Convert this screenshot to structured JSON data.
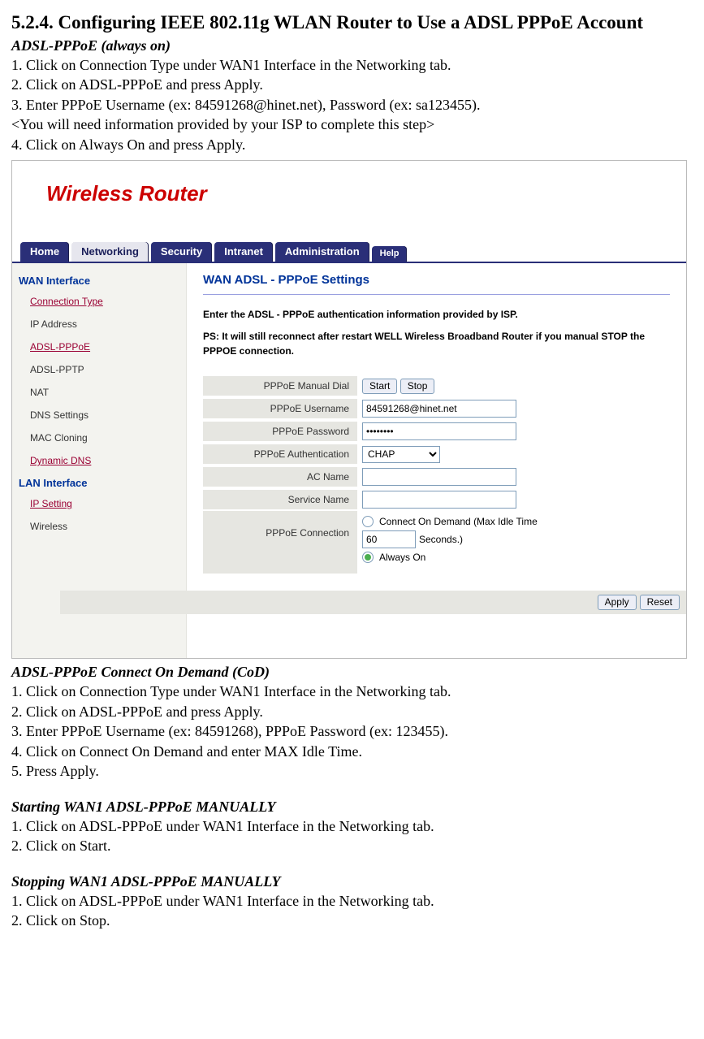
{
  "doc": {
    "heading": "5.2.4. Configuring IEEE 802.11g WLAN Router to Use a ADSL PPPoE Account",
    "section1": {
      "title": "ADSL-PPPoE (always on)",
      "steps": [
        "1. Click on Connection Type under WAN1 Interface in the Networking tab.",
        "2. Click on ADSL-PPPoE and press Apply.",
        "3. Enter PPPoE Username (ex: 84591268@hinet.net), Password (ex: sa123455).",
        "<You will need information provided by your ISP to complete this step>",
        "4. Click on Always On and press Apply."
      ]
    },
    "section2": {
      "title": "ADSL-PPPoE Connect On Demand (CoD)",
      "steps": [
        "1. Click on Connection Type under WAN1 Interface in the Networking tab.",
        "2. Click on ADSL-PPPoE and press Apply.",
        "3. Enter PPPoE Username (ex: 84591268), PPPoE Password (ex: 123455).",
        "4. Click on Connect On Demand and enter MAX Idle Time.",
        "5. Press Apply."
      ]
    },
    "section3": {
      "title": "Starting WAN1 ADSL-PPPoE MANUALLY",
      "steps": [
        "1. Click on ADSL-PPPoE under WAN1 Interface in the Networking tab.",
        "2. Click on Start."
      ]
    },
    "section4": {
      "title": "Stopping WAN1 ADSL-PPPoE MANUALLY",
      "steps": [
        "1. Click on ADSL-PPPoE under WAN1 Interface in the Networking tab.",
        "2. Click on Stop."
      ]
    }
  },
  "router": {
    "brand": "Wireless Router",
    "tabs": {
      "home": "Home",
      "networking": "Networking",
      "security": "Security",
      "intranet": "Intranet",
      "administration": "Administration",
      "help": "Help"
    },
    "sidebar": {
      "wan_cat": "WAN Interface",
      "items_wan": [
        "Connection Type",
        "IP Address",
        "ADSL-PPPoE",
        "ADSL-PPTP",
        "NAT",
        "DNS Settings",
        "MAC Cloning",
        "Dynamic DNS"
      ],
      "lan_cat": "LAN Interface",
      "items_lan": [
        "IP Setting",
        "Wireless"
      ]
    },
    "content": {
      "title": "WAN ADSL - PPPoE Settings",
      "intro1": "Enter the ADSL - PPPoE authentication information provided by ISP.",
      "intro2": "PS: It will still reconnect after restart WELL Wireless Broadband Router if you manual STOP the PPPOE connection.",
      "labels": {
        "manual_dial": "PPPoE Manual Dial",
        "username": "PPPoE Username",
        "password": "PPPoE Password",
        "auth": "PPPoE Authentication",
        "ac_name": "AC Name",
        "service_name": "Service Name",
        "connection": "PPPoE Connection"
      },
      "values": {
        "start_btn": "Start",
        "stop_btn": "Stop",
        "username": "84591268@hinet.net",
        "password": "••••••••",
        "auth": "CHAP",
        "ac_name": "",
        "service_name": "",
        "idle_time": "60",
        "cod_label_a": "Connect On Demand (Max Idle Time",
        "cod_label_b": "Seconds.)",
        "always_on": "Always On"
      },
      "footer": {
        "apply": "Apply",
        "reset": "Reset"
      }
    }
  }
}
